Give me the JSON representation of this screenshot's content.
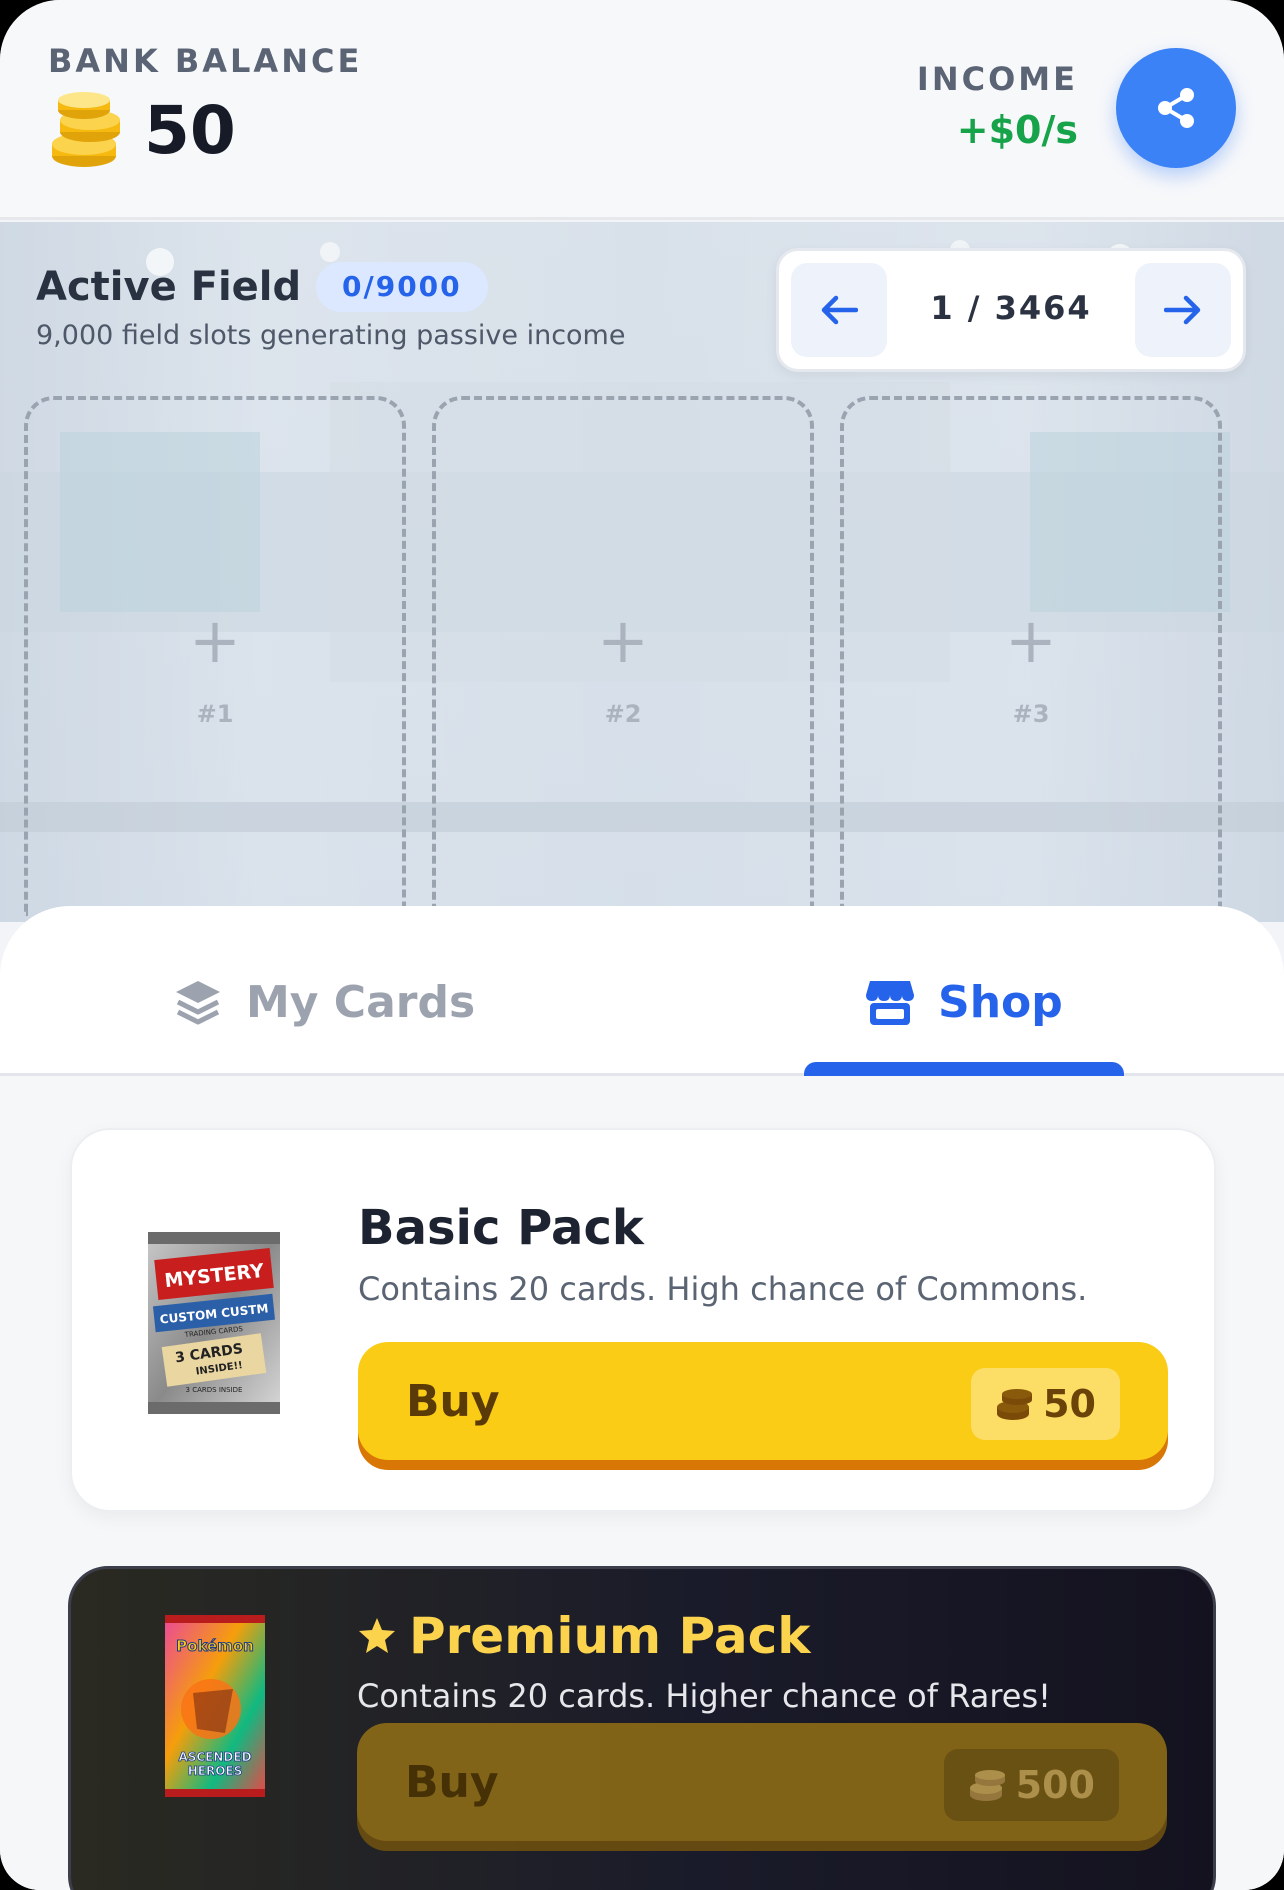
{
  "header": {
    "bank_label": "BANK BALANCE",
    "bank_value": "50",
    "income_label": "INCOME",
    "income_value": "+$0/s"
  },
  "field": {
    "title": "Active Field",
    "badge": "0/9000",
    "subtitle": "9,000 field slots generating passive income",
    "page_indicator": "1 / 3464",
    "slots": [
      {
        "label": "#1"
      },
      {
        "label": "#2"
      },
      {
        "label": "#3"
      }
    ]
  },
  "tabs": {
    "my_cards": "My Cards",
    "shop": "Shop",
    "active": "shop"
  },
  "shop": {
    "basic": {
      "title": "Basic Pack",
      "description": "Contains 20 cards. High chance of Commons.",
      "buy_label": "Buy",
      "price": "50"
    },
    "premium": {
      "title": "Premium Pack",
      "description": "Contains 20 cards. Higher chance of Rares!",
      "buy_label": "Buy",
      "price": "500"
    }
  },
  "pack_art": {
    "basic_lines": [
      "MYSTERY",
      "CUSTOM CUSTM",
      "TRADING CARDS",
      "3 CARDS",
      "INSIDE!!",
      "3 CARDS INSIDE"
    ],
    "premium_lines": [
      "Pokémon",
      "ASCENDED",
      "HEROES"
    ]
  },
  "icons": {
    "coins": "coin-stack-icon",
    "share": "share-icon",
    "prev": "arrow-left-icon",
    "next": "arrow-right-icon",
    "cards": "layers-icon",
    "shop": "store-icon",
    "star": "star-icon"
  },
  "colors": {
    "accent": "#3b82f6",
    "income": "#16a34a",
    "buy": "#facc15",
    "premium_title": "#fcd34d"
  }
}
